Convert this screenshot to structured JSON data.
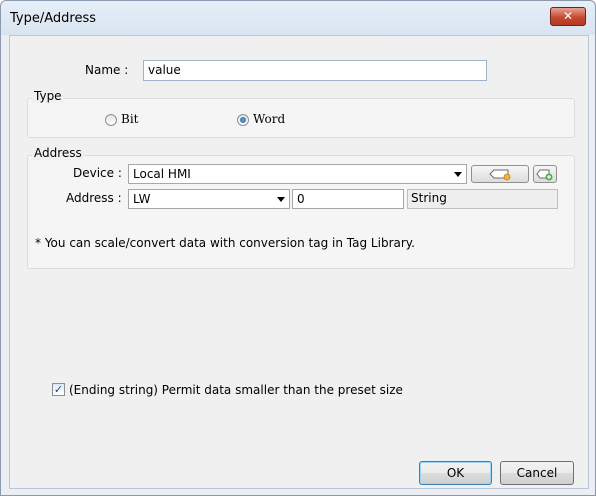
{
  "window": {
    "title": "Type/Address",
    "close_glyph": "✕"
  },
  "name_field": {
    "label": "Name :",
    "value": "value"
  },
  "type_group": {
    "title": "Type",
    "options": [
      {
        "label": "Bit",
        "checked": false
      },
      {
        "label": "Word",
        "checked": true
      }
    ]
  },
  "address_group": {
    "title": "Address",
    "device_label": "Device :",
    "device_value": "Local HMI",
    "address_label": "Address :",
    "address_type": "LW",
    "address_value": "0",
    "address_format": "String",
    "note": "* You can scale/convert data with conversion tag in Tag Library."
  },
  "ending_string": {
    "checked": true,
    "check_glyph": "✓",
    "label": "(Ending string) Permit data smaller than the preset size"
  },
  "buttons": {
    "ok": "OK",
    "cancel": "Cancel"
  },
  "colors": {
    "close_button": "#c64a33",
    "radio_checked": "#1b5c9c",
    "title_bar": "#dbe6f2"
  }
}
